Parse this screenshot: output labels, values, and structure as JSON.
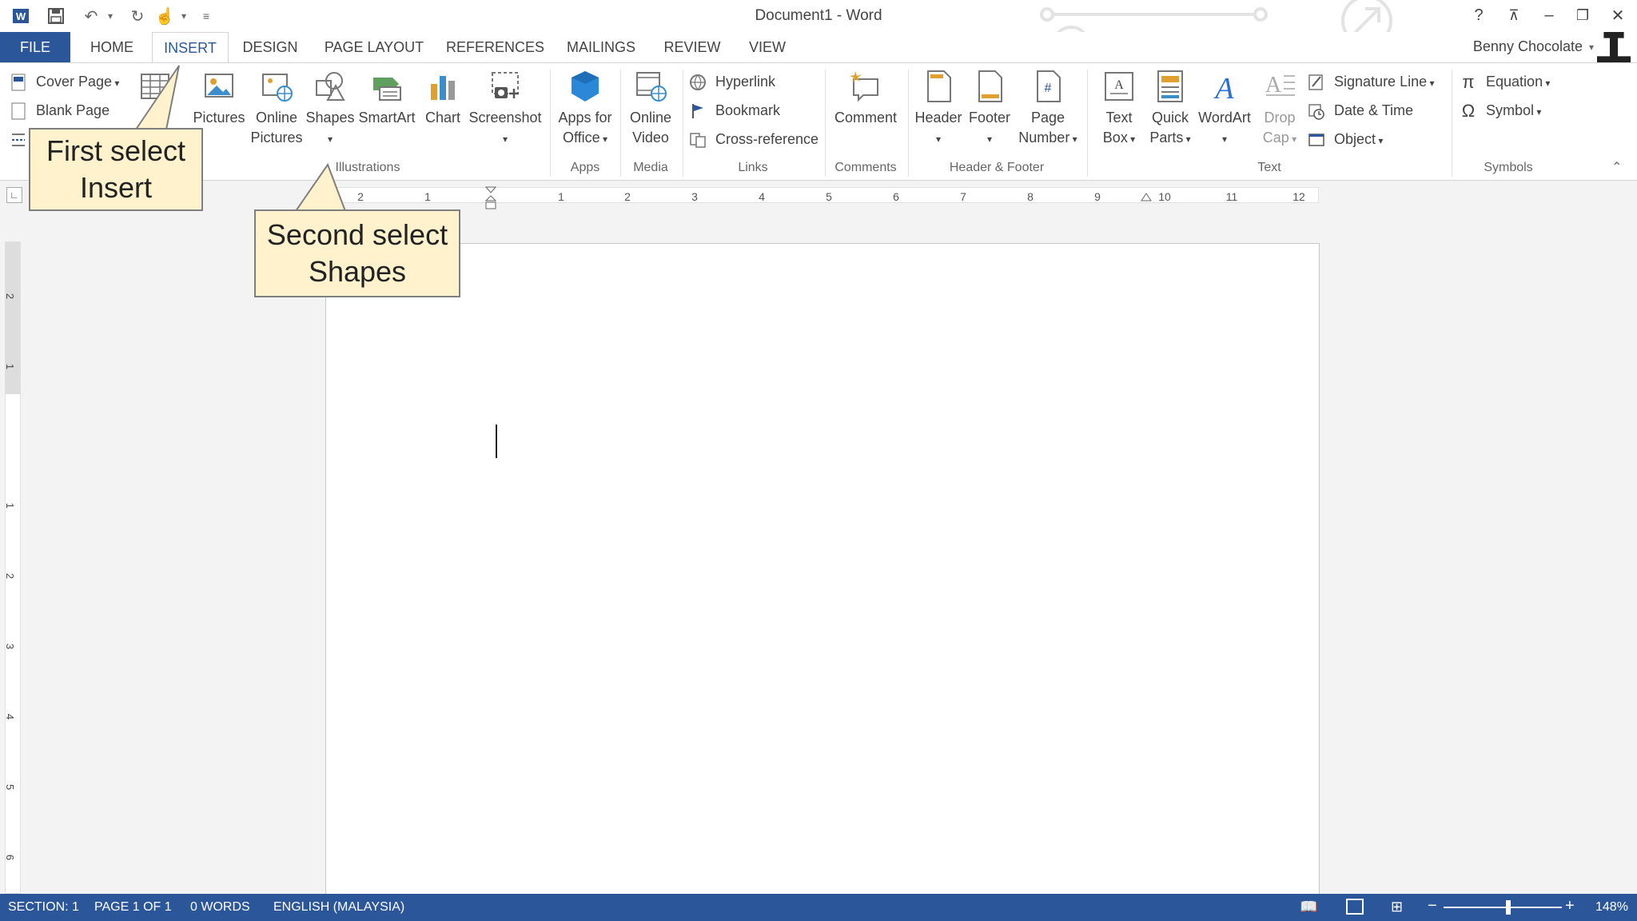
{
  "window": {
    "title": "Document1 - Word",
    "user_name": "Benny Chocolate"
  },
  "tabs": [
    "FILE",
    "HOME",
    "INSERT",
    "DESIGN",
    "PAGE LAYOUT",
    "REFERENCES",
    "MAILINGS",
    "REVIEW",
    "VIEW"
  ],
  "ribbon": {
    "pages": {
      "cover_page": "Cover Page",
      "blank_page": "Blank Page"
    },
    "illustrations": {
      "pictures": "Pictures",
      "online_pictures_1": "Online",
      "online_pictures_2": "Pictures",
      "shapes": "Shapes",
      "smartart": "SmartArt",
      "chart": "Chart",
      "screenshot": "Screenshot",
      "group": "Illustrations"
    },
    "apps": {
      "apps_1": "Apps for",
      "apps_2": "Office",
      "group": "Apps"
    },
    "media": {
      "video_1": "Online",
      "video_2": "Video",
      "group": "Media"
    },
    "links": {
      "hyperlink": "Hyperlink",
      "bookmark": "Bookmark",
      "cross_reference": "Cross-reference",
      "group": "Links"
    },
    "comments": {
      "comment": "Comment",
      "group": "Comments"
    },
    "header_footer": {
      "header": "Header",
      "footer": "Footer",
      "page_number_1": "Page",
      "page_number_2": "Number",
      "group": "Header & Footer"
    },
    "text": {
      "text_box_1": "Text",
      "text_box_2": "Box",
      "quick_parts_1": "Quick",
      "quick_parts_2": "Parts",
      "wordart": "WordArt",
      "drop_cap_1": "Drop",
      "drop_cap_2": "Cap",
      "signature_line": "Signature Line",
      "date_time": "Date & Time",
      "object": "Object",
      "group": "Text"
    },
    "symbols": {
      "equation": "Equation",
      "symbol": "Symbol",
      "group": "Symbols"
    }
  },
  "ruler": {
    "ticks": [
      "2",
      "1",
      "1",
      "2",
      "3",
      "4",
      "5",
      "6",
      "7",
      "8",
      "9",
      "10",
      "11",
      "12"
    ]
  },
  "vruler": {
    "ticks": [
      "2",
      "1",
      "1",
      "2",
      "3",
      "4",
      "5",
      "6"
    ]
  },
  "callouts": {
    "first_line1": "First select",
    "first_line2": "Insert",
    "second_line1": "Second select",
    "second_line2": "Shapes"
  },
  "status": {
    "section": "SECTION: 1",
    "page": "PAGE 1 OF 1",
    "words": "0 WORDS",
    "language": "ENGLISH (MALAYSIA)",
    "zoom": "148%"
  },
  "colors": {
    "accent": "#2b579a",
    "callout_fill": "#fff2cc"
  }
}
